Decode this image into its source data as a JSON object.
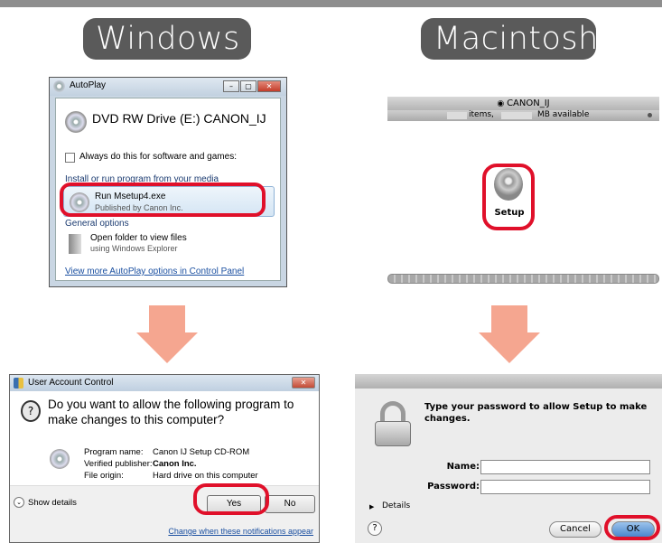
{
  "headers": {
    "windows": "Windows",
    "mac": "Macintosh"
  },
  "autoplay": {
    "title": "AutoPlay",
    "window_buttons": [
      "–",
      "▢",
      "✕"
    ],
    "drive": "DVD RW Drive (E:) CANON_IJ",
    "always_do": "Always do this for software and games:",
    "install_section": "Install or run program from your media",
    "run_label": "Run Msetup4.exe",
    "run_publisher": "Published by Canon Inc.",
    "general_options": "General options",
    "open_folder": "Open folder to view files",
    "open_folder_sub": "using Windows Explorer",
    "more_link": "View more AutoPlay options in Control Panel"
  },
  "finder": {
    "title": "CANON_IJ",
    "status_items": "items,",
    "status_available": "MB available",
    "setup_label": "Setup"
  },
  "uac": {
    "title": "User Account Control",
    "question": "Do you want to allow the following program to make changes to this computer?",
    "program_name_label": "Program name:",
    "program_name_value": "Canon IJ Setup CD-ROM",
    "publisher_label": "Verified publisher:",
    "publisher_value": "Canon Inc.",
    "origin_label": "File origin:",
    "origin_value": "Hard drive on this computer",
    "show_details": "Show details",
    "yes": "Yes",
    "no": "No",
    "change_link": "Change when these notifications appear"
  },
  "auth": {
    "message": "Type your password to allow Setup to make changes.",
    "name_label": "Name:",
    "password_label": "Password:",
    "details": "Details",
    "help": "?",
    "cancel": "Cancel",
    "ok": "OK"
  },
  "colors": {
    "highlight": "#e0102a",
    "arrow": "#f5a690",
    "header_bg": "#5a5a5a"
  }
}
